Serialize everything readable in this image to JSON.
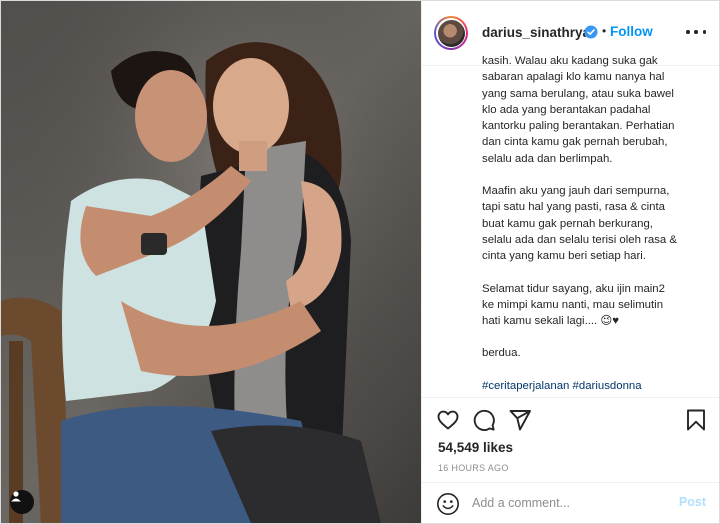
{
  "post": {
    "username": "darius_sinathrya",
    "follow_label": "Follow",
    "separator": "•",
    "caption_paragraphs": [
      "kasih. Walau aku kadang suka gak\nsabaran apalagi klo kamu nanya hal\nyang sama berulang, atau suka bawel\nklo ada yang berantakan padahal\nkantorku paling berantakan. Perhatian\ndan cinta kamu gak pernah berubah,\nselalu ada dan berlimpah.",
      "Maafin aku yang jauh dari sempurna,\ntapi satu hal yang pasti, rasa & cinta\nbuat kamu gak pernah berkurang,\nselalu ada dan selalu terisi oleh rasa &\ncinta yang kamu beri setiap hari.",
      "Selamat tidur sayang, aku ijin main2\nke mimpi kamu nanti, mau selimutin\nhati kamu sekali lagi.... 😉♥",
      "berdua."
    ],
    "hashtags": "#ceritaperjalanan #dariusdonna",
    "likes": "54,549 likes",
    "time": "16 HOURS AGO",
    "comment_placeholder": "Add a comment...",
    "post_label": "Post"
  },
  "icons": {
    "like": "heart-icon",
    "comment": "comment-icon",
    "share": "paper-plane-icon",
    "save": "bookmark-icon",
    "emoji": "smiley-icon",
    "tag": "user-tag-icon",
    "verified": "verified-badge-icon",
    "more": "more-options-icon"
  },
  "colors": {
    "link": "#0095f6",
    "verified": "#3897f0",
    "hashtag": "#00376b",
    "post_disabled": "#b2dffc"
  }
}
